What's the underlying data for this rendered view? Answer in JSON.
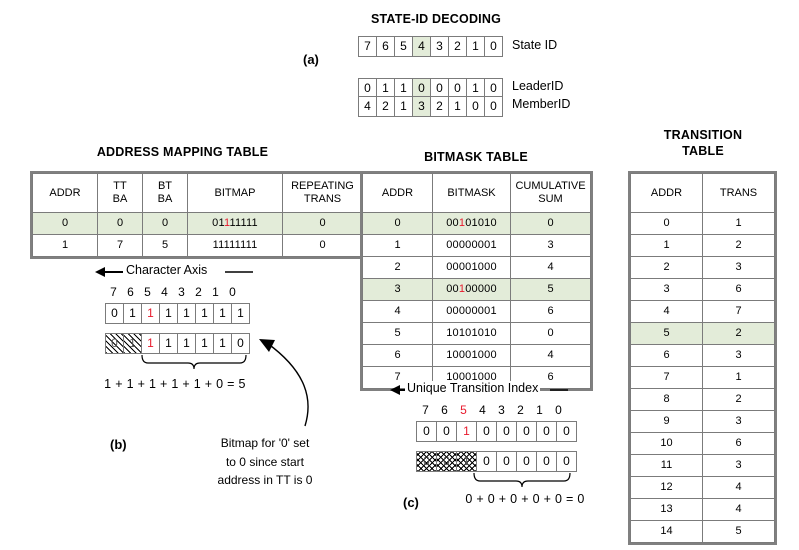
{
  "panels": {
    "a_label": "(a)",
    "b_label": "(b)",
    "c_label": "(c)"
  },
  "state_id_decoding": {
    "title": "STATE-ID DECODING",
    "rows": [
      {
        "name": "State ID",
        "label": "State ID",
        "cells": [
          "7",
          "6",
          "5",
          "4",
          "3",
          "2",
          "1",
          "0"
        ],
        "highlight_index": 3
      },
      {
        "name": "LeaderID",
        "label": "LeaderID",
        "cells": [
          "0",
          "1",
          "1",
          "0",
          "0",
          "0",
          "1",
          "0"
        ],
        "highlight_index": 3
      },
      {
        "name": "MemberID",
        "label": "MemberID",
        "cells": [
          "4",
          "2",
          "1",
          "3",
          "2",
          "1",
          "0",
          "0"
        ],
        "highlight_index": 3
      }
    ]
  },
  "address_mapping_table": {
    "title": "ADDRESS MAPPING TABLE",
    "headers": [
      "ADDR",
      "TT\nBA",
      "BT\nBA",
      "BITMAP",
      "REPEATING\nTRANS"
    ],
    "headers_flat": [
      "ADDR",
      "TT BA",
      "BT BA",
      "BITMAP",
      "REPEATING TRANS"
    ],
    "rows": [
      {
        "addr": "0",
        "tt_ba": "0",
        "bt_ba": "0",
        "bitmap_pre": "01",
        "bitmap_red": "1",
        "bitmap_post": "11111",
        "bitmap": "01111111",
        "repeating_trans": "0",
        "highlight": true
      },
      {
        "addr": "1",
        "tt_ba": "7",
        "bt_ba": "5",
        "bitmap_pre": "11111111",
        "bitmap_red": "",
        "bitmap_post": "",
        "bitmap": "11111111",
        "repeating_trans": "0",
        "highlight": false
      }
    ]
  },
  "bitmask_table": {
    "title": "BITMASK TABLE",
    "headers": [
      "ADDR",
      "BITMASK",
      "CUMULATIVE\nSUM"
    ],
    "headers_flat": [
      "ADDR",
      "BITMASK",
      "CUMULATIVE SUM"
    ],
    "rows": [
      {
        "addr": "0",
        "pre": "00",
        "red": "1",
        "post": "01010",
        "bitmask": "00101010",
        "cumulative_sum": "0",
        "highlight": true
      },
      {
        "addr": "1",
        "pre": "00000001",
        "red": "",
        "post": "",
        "bitmask": "00000001",
        "cumulative_sum": "3",
        "highlight": false
      },
      {
        "addr": "2",
        "pre": "00001000",
        "red": "",
        "post": "",
        "bitmask": "00001000",
        "cumulative_sum": "4",
        "highlight": false
      },
      {
        "addr": "3",
        "pre": "00",
        "red": "1",
        "post": "00000",
        "bitmask": "00100000",
        "cumulative_sum": "5",
        "highlight": true
      },
      {
        "addr": "4",
        "pre": "00000001",
        "red": "",
        "post": "",
        "bitmask": "00000001",
        "cumulative_sum": "6",
        "highlight": false
      },
      {
        "addr": "5",
        "pre": "10101010",
        "red": "",
        "post": "",
        "bitmask": "10101010",
        "cumulative_sum": "0",
        "highlight": false
      },
      {
        "addr": "6",
        "pre": "10001000",
        "red": "",
        "post": "",
        "bitmask": "10001000",
        "cumulative_sum": "4",
        "highlight": false
      },
      {
        "addr": "7",
        "pre": "10001000",
        "red": "",
        "post": "",
        "bitmask": "10001000",
        "cumulative_sum": "6",
        "highlight": false
      }
    ]
  },
  "transition_table": {
    "title_line1": "TRANSITION",
    "title_line2": "TABLE",
    "headers": [
      "ADDR",
      "TRANS"
    ],
    "rows": [
      {
        "addr": "0",
        "trans": "1",
        "highlight": false
      },
      {
        "addr": "1",
        "trans": "2",
        "highlight": false
      },
      {
        "addr": "2",
        "trans": "3",
        "highlight": false
      },
      {
        "addr": "3",
        "trans": "6",
        "highlight": false
      },
      {
        "addr": "4",
        "trans": "7",
        "highlight": false
      },
      {
        "addr": "5",
        "trans": "2",
        "highlight": true
      },
      {
        "addr": "6",
        "trans": "3",
        "highlight": false
      },
      {
        "addr": "7",
        "trans": "1",
        "highlight": false
      },
      {
        "addr": "8",
        "trans": "2",
        "highlight": false
      },
      {
        "addr": "9",
        "trans": "3",
        "highlight": false
      },
      {
        "addr": "10",
        "trans": "6",
        "highlight": false
      },
      {
        "addr": "11",
        "trans": "3",
        "highlight": false
      },
      {
        "addr": "12",
        "trans": "4",
        "highlight": false
      },
      {
        "addr": "13",
        "trans": "4",
        "highlight": false
      },
      {
        "addr": "14",
        "trans": "5",
        "highlight": false
      }
    ]
  },
  "panel_b": {
    "axis_label": "Character Axis",
    "index_row": [
      "7",
      "6",
      "5",
      "4",
      "3",
      "2",
      "1",
      "0"
    ],
    "index_red": [],
    "bitmap_row": [
      {
        "v": "0",
        "red": false
      },
      {
        "v": "1",
        "red": false
      },
      {
        "v": "1",
        "red": true
      },
      {
        "v": "1",
        "red": false
      },
      {
        "v": "1",
        "red": false
      },
      {
        "v": "1",
        "red": false
      },
      {
        "v": "1",
        "red": false
      },
      {
        "v": "1",
        "red": false
      }
    ],
    "masked_row": [
      {
        "v": "0",
        "red": false,
        "hatch": true
      },
      {
        "v": "1",
        "red": false,
        "hatch": true
      },
      {
        "v": "1",
        "red": true,
        "hatch": false
      },
      {
        "v": "1",
        "red": false,
        "hatch": false
      },
      {
        "v": "1",
        "red": false,
        "hatch": false
      },
      {
        "v": "1",
        "red": false,
        "hatch": false
      },
      {
        "v": "1",
        "red": false,
        "hatch": false
      },
      {
        "v": "0",
        "red": false,
        "hatch": false
      }
    ],
    "sum_expression": "1 + 1 + 1 + 1 + 1 + 0 = 5",
    "note": "Bitmap for  '0' set to 0 since start address in TT is 0",
    "note_lines": [
      "Bitmap for  '0' set",
      "to 0 since start",
      "address in TT is 0"
    ]
  },
  "panel_c": {
    "axis_label": "Unique Transition Index",
    "index_row": [
      "7",
      "6",
      "5",
      "4",
      "3",
      "2",
      "1",
      "0"
    ],
    "index_red_position": 2,
    "bitmask_row": [
      {
        "v": "0",
        "red": false
      },
      {
        "v": "0",
        "red": false
      },
      {
        "v": "1",
        "red": true
      },
      {
        "v": "0",
        "red": false
      },
      {
        "v": "0",
        "red": false
      },
      {
        "v": "0",
        "red": false
      },
      {
        "v": "0",
        "red": false
      },
      {
        "v": "0",
        "red": false
      }
    ],
    "masked_row": [
      {
        "v": "0",
        "red": false,
        "hatch": true
      },
      {
        "v": "0",
        "red": false,
        "hatch": true
      },
      {
        "v": "1",
        "red": true,
        "hatch": true
      },
      {
        "v": "0",
        "red": false,
        "hatch": false
      },
      {
        "v": "0",
        "red": false,
        "hatch": false
      },
      {
        "v": "0",
        "red": false,
        "hatch": false
      },
      {
        "v": "0",
        "red": false,
        "hatch": false
      },
      {
        "v": "0",
        "red": false,
        "hatch": false
      }
    ],
    "sum_expression": "0 + 0 + 0 + 0 + 0 = 0"
  },
  "colors": {
    "highlight_green": "#e3ecd9",
    "red_accent": "#e8192c",
    "border": "#7b7b7b",
    "outer_border": "#808080"
  }
}
